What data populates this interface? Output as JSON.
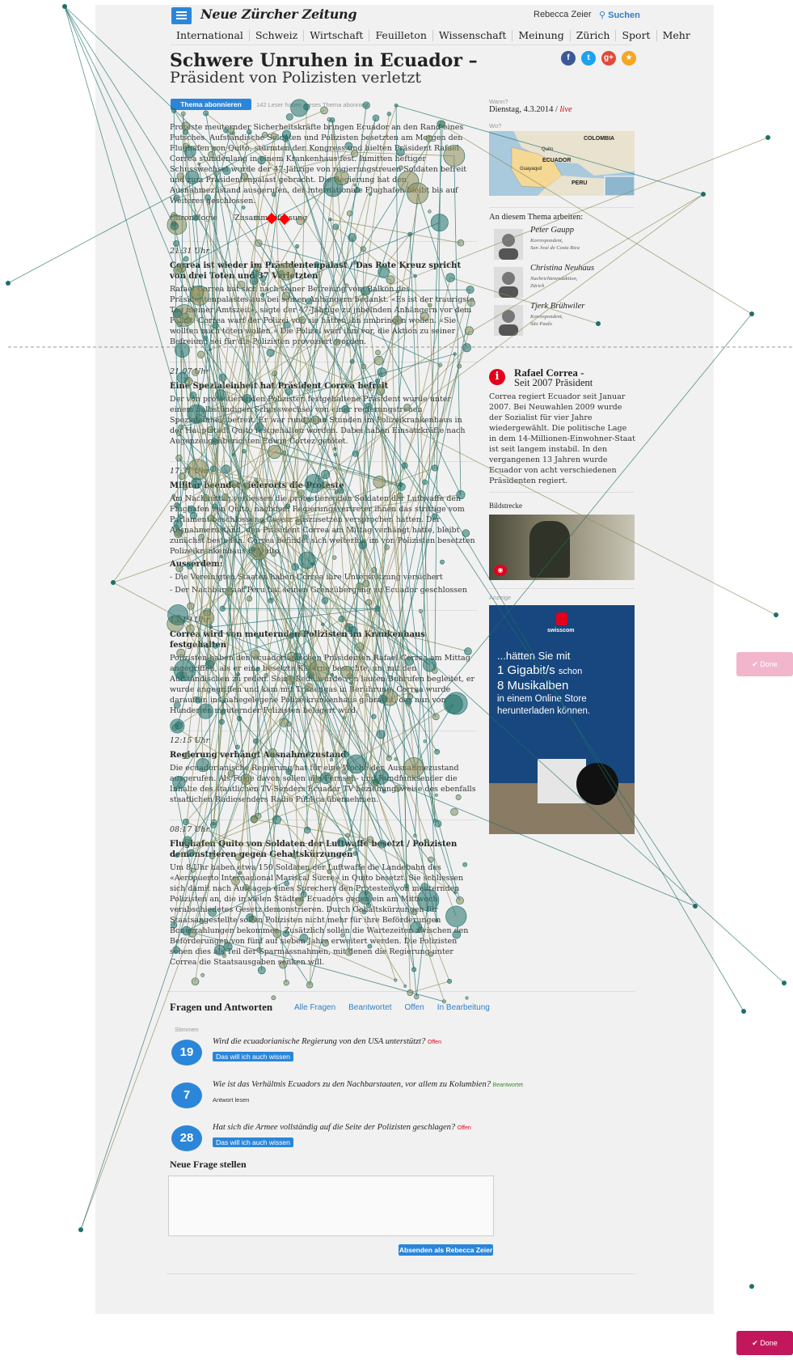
{
  "header": {
    "logo": "Neue Zürcher Zeitung",
    "user_name": "Rebecca Zeier",
    "search_label": "Suchen"
  },
  "nav": [
    "International",
    "Schweiz",
    "Wirtschaft",
    "Feuilleton",
    "Wissenschaft",
    "Meinung",
    "Zürich",
    "Sport",
    "Mehr"
  ],
  "article": {
    "title": "Schwere Unruhen in Ecuador –",
    "subtitle": "Präsident von Polizisten verletzt",
    "subscribe_button": "Thema abonnieren",
    "subscribers_note": "142 Leser haben dieses Thema abonniert",
    "intro": "Proteste meuternder Sicherheitskräfte bringen Ecuador an den Rand eines Putsches. Aufständische Soldaten und Polizisten besetzten am Morgen den Flughafen von Quito, stürmten den Kongress und hielten Präsident Rafael Correa stundenlang in einem Krankenhaus fest. Inmitten heftiger Schusswechsel wurde der 47-Jährige von regierungstreuen Soldaten befreit und zum Präsidentenpalast gebracht. Die Regierung hat den Ausnahmezustand ausgerufen, der internationale Flughafen bleibt bis auf Weiteres geschlossen.",
    "link_chronology": "Chronologie",
    "link_summary": "Zusammenfassung"
  },
  "entries": [
    {
      "time": "21:31 Uhr",
      "headline": "Correa ist wieder im Präsidentenpalast / Das Rote Kreuz spricht von drei Toten und 37 Verletzten",
      "text": "Rafael Correa hat sich nach seiner Befreiung vom Balkon des Präsidentenpalastes aus bei seinen Anhängern bedankt. «Es ist der traurigste Tag meiner Amtszeit», sagte der 47-Jährige zu jubelnden Anhängern vor dem Palast. Correa warf der Polizei vor, sie hätten ihn umbringen wollen. «Sie wollten mich töten wollen.» Die Polizei warf ihm vor, die Aktion zu seiner Befreiung sei für die Polizisten provoziert worden."
    },
    {
      "time": "21:07 Uhr",
      "headline": "Eine Spezialeinheit hat Präsident Correa befreit",
      "text": "Der von protestierenden Polizisten festgehaltene Präsident wurde unter einem halbstündigen Schusswechsel von einer regierungstreuen Spezialeinheit befreit. Er war rund zehn Stunden im Polizeikrankenhaus in der Hauptstadt Quito festgehalten worden. Dabei haben Einsatzkräfte nach Augenzeugenberichten Edwin Cortez getötet."
    },
    {
      "time": "17:31 Uhr",
      "headline": "Militär beendet vielerorts die Proteste",
      "text": "Am Nachmittag verliessen die protestierenden Soldaten der Luftwaffe den Flughafen von Quito, nachdem Regierungsvertreter ihnen das strittige vom Parlament beschlossene Gesetz auszusetzen versprochen hatten. Der Ausnahmezustand, den Präsident Correa am Mittag verhängt hatte, bleibt zunächst bestehen. Correa befindet sich weiterhin im von Polizisten besetzten Polizeikrankenhaus in Quito.",
      "extra_heading": "Ausserdem:",
      "bullets": [
        "- Die Vereinigten Staaten haben Correa ihre Unterstützung versichert",
        "- Der Nachbarstaat Peru hat seinen Grenzübergang zu Ecuador geschlossen"
      ]
    },
    {
      "time": "13:19 Uhr",
      "headline": "Correa wird von meuternden Polizisten im Krankenhaus festgehalten",
      "text": "Polizisten haben den ecuadorianischen Präsidenten Rafael Correa am Mittag angegriffen, als er eine besetzte Kaserne besuchte, um mit den Aufständischen zu reden. Seine Rede wurde von lauten Buhrufen begleitet, er wurde angegriffen und kam mit Tränengas in Berührung. Correa wurde daraufhin ins nahegelegene Polizeikrankenhaus gebracht, das nun von Hunderten meuternder Polizisten belagert wird."
    },
    {
      "time": "12:15 Uhr",
      "headline": "Regierung verhängt Ausnahmezustand",
      "text": "Die ecuadorianische Regierung hat für eine Woche den Ausnahmezustand ausgerufen. Als Folge davon sollen alle Fernseh- und Rundfunksender die Inhalte des staatlichen TV-Senders Ecuador TV beziehungsweise des ebenfalls staatlichen Radiosenders Radio Pública übernehmen."
    },
    {
      "time": "08:17 Uhr",
      "headline": "Flughafen Quito von Soldaten der Luftwaffe besetzt / Polizisten demonstrieren gegen Gehaltskürzungen",
      "text": "Um 8 Uhr haben etwa 150 Soldaten der Luftwaffe die Landebahn des «Aeropuerto Internacional Mariscal Sucre» in Quito besetzt. Sie schliessen sich damit nach Aussagen eines Sprechers den Protesten von meuternden Polizisten an, die in vielen Städten Ecuadors gegen ein am Mittwoch verabschiedetes Gesetz demonstrieren. Durch Gehaltskürzungen für Staatsangestellte sollen Polizisten nicht mehr für ihre Beförderungen Bonuszahlungen bekommen. Zusätzlich sollen die Wartezeiten zwischen den Beförderungen von fünf auf sieben Jahre erweitert werden. Die Polizisten sehen dies als Teil der Sparmassnahmen, mit denen die Regierung unter Correa die Staatsausgaben senken will."
    }
  ],
  "sidebar": {
    "when_label": "Wann?",
    "date": "Dienstag, 4.3.2014 /",
    "live": "live",
    "where_label": "Wo?",
    "map_labels": [
      "COLOMBIA",
      "Quito",
      "ECUADOR",
      "Guayaquil",
      "PERU"
    ],
    "team_heading": "An diesem Thema arbeiten:",
    "team": [
      {
        "name": "Peter Gaupp",
        "role": "Korrespondent,",
        "location": "San José de Costa Rica"
      },
      {
        "name": "Christina Neuhaus",
        "role": "Nachrichtenredaktion,",
        "location": "Zürich"
      },
      {
        "name": "Tjerk Brühwiler",
        "role": "Korrespondent,",
        "location": "São Paulo"
      }
    ],
    "info_title": "Rafael Correa -",
    "info_subtitle": "Seit 2007 Präsident",
    "info_text": "Correa regiert Ecuador seit Januar 2007. Bei Neuwahlen 2009 wurde der Sozialist für vier Jahre wiedergewählt. Die politische Lage in dem 14-Millionen-Einwohner-Staat ist seit langem instabil. In den vergangenen 13 Jahren wurde Ecuador von acht verschiedenen Präsidenten regiert.",
    "gallery_label": "Bildstrecke",
    "ad_label": "Anzeige",
    "ad_brand": "swisscom",
    "ad_line1": "...hätten Sie mit",
    "ad_line2": "1 Gigabit/s",
    "ad_line2b": "schon",
    "ad_line3": "8 Musikalben",
    "ad_line4": "in einem Online Store",
    "ad_line5": "herunterladen können."
  },
  "qa": {
    "heading": "Fragen und Antworten",
    "filters": [
      "Alle Fragen",
      "Beantwortet",
      "Offen",
      "In Bearbeitung"
    ],
    "votes_label": "Stimmen",
    "questions": [
      {
        "votes": "19",
        "text": "Wird die ecuadorianische Regierung von den USA unterstützt?",
        "status": "Offen",
        "action": "Das will ich auch wissen"
      },
      {
        "votes": "7",
        "text": "Wie ist das Verhältnis Ecuadors zu den Nachbarstaaten, vor allem zu Kolumbien?",
        "status": "Beantwortet",
        "action": "Antwort lesen"
      },
      {
        "votes": "28",
        "text": "Hat sich die Armee vollständig auf die Seite der Polizisten geschlagen?",
        "status": "Offen",
        "action": "Das will ich auch wissen"
      }
    ],
    "new_question_heading": "Neue Frage stellen",
    "submit_button": "Absenden als Rebecca Zeier"
  },
  "done_buttons": {
    "label": "Done"
  },
  "colors": {
    "accent": "#2b86d9",
    "gaze_teal": "#1f6f6a",
    "gaze_olive": "#8a8a55",
    "done_pink": "#f2b6cc",
    "done_crimson": "#c2185b"
  }
}
